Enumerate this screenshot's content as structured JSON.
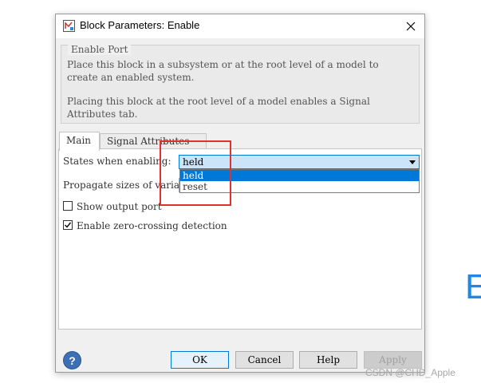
{
  "dialog": {
    "title": "Block Parameters: Enable",
    "close_icon": "close-icon"
  },
  "groupbox": {
    "label": "Enable Port",
    "desc1_line1": "Place this block in a subsystem or at the root level of a model to",
    "desc1_line2": "create an enabled system.",
    "desc2_line1": "Placing this block at the root level of a model enables a Signal",
    "desc2_line2": "Attributes tab."
  },
  "tabs": [
    {
      "label": "Main",
      "active": true
    },
    {
      "label": "Signal Attributes",
      "active": false
    }
  ],
  "main": {
    "states_label": "States when enabling:",
    "states_value": "held",
    "states_options": [
      "held",
      "reset"
    ],
    "propagate_label": "Propagate sizes of variable-size signals:",
    "show_output_port_label": "Show output port",
    "show_output_port_checked": false,
    "zero_crossing_label": "Enable zero-crossing detection",
    "zero_crossing_checked": true
  },
  "buttons": {
    "ok": "OK",
    "cancel": "Cancel",
    "help": "Help",
    "apply": "Apply"
  },
  "background": {
    "side_letter": "E",
    "watermark": "CSDN @CHD_Apple"
  }
}
